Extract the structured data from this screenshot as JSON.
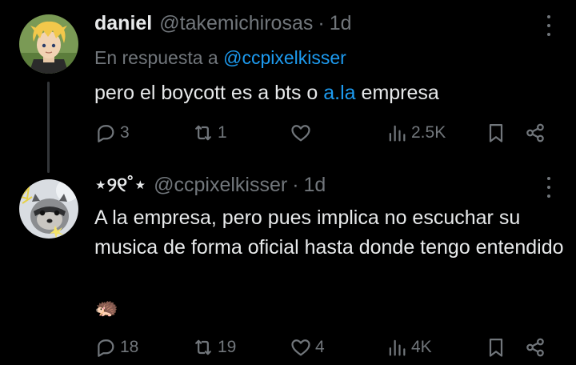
{
  "thread": [
    {
      "display_name": "daniel",
      "handle": "@takemichirosas",
      "separator": "·",
      "time": "1d",
      "reply_prefix": "En respuesta a",
      "reply_mention": "@ccpixelkisser",
      "text_before": "pero el boycott es a bts o ",
      "text_link": "a.la",
      "text_after": " empresa",
      "replies": "3",
      "reposts": "1",
      "likes": "",
      "views": "2.5K",
      "avatar_icon": "anime-avatar-icon"
    },
    {
      "display_name": "⋆୨୧˚⋆",
      "handle": "@ccpixelkisser",
      "separator": "·",
      "time": "1d",
      "text": "A la empresa, pero pues implica no escuchar su musica de forma oficial hasta donde tengo entendido",
      "emoji": "🦔",
      "replies": "18",
      "reposts": "19",
      "likes": "4",
      "views": "4K",
      "avatar_icon": "raccoon-avatar-icon"
    }
  ],
  "colors": {
    "background": "#000000",
    "text": "#e7e9ea",
    "muted": "#71767b",
    "accent": "#1d9bf0",
    "thread_line": "#333639"
  }
}
